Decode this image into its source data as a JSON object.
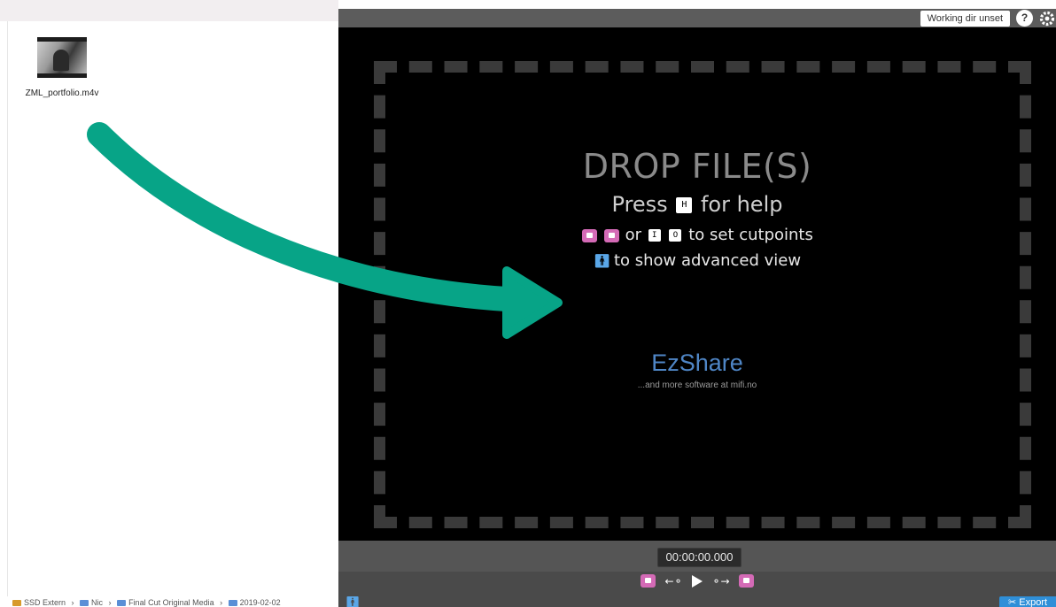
{
  "finder": {
    "file": {
      "name": "ZML_portfolio.m4v"
    },
    "path": [
      {
        "icon": "drive-icon",
        "label": "SSD Extern"
      },
      {
        "icon": "folder-icon",
        "label": "Nic"
      },
      {
        "icon": "folder-icon",
        "label": "Final Cut Original Media"
      },
      {
        "icon": "folder-icon",
        "label": "2019-02-02"
      }
    ]
  },
  "app": {
    "topbar": {
      "working_dir": "Working dir unset",
      "help_label": "?"
    },
    "drop": {
      "title": "DROP FILE(S)",
      "help_prefix": "Press",
      "help_key": "H",
      "help_suffix": "for help",
      "or_word": "or",
      "cut_key_in": "I",
      "cut_key_out": "O",
      "cut_suffix": "to set cutpoints",
      "advanced_text": "to show advanced view"
    },
    "brand": {
      "name": "EzShare",
      "tagline": "...and more software at mifi.no"
    },
    "player": {
      "timecode": "00:00:00.000",
      "export_label": "Export"
    }
  },
  "colors": {
    "arrow": "#07a487",
    "brand": "#4f86c6",
    "cut_key": "#d46ab6",
    "accent_blue": "#2f8fd8"
  }
}
